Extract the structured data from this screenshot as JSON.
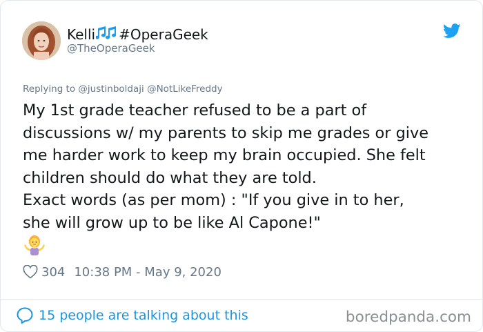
{
  "author": {
    "display_name_prefix": "Kelli",
    "display_name_suffix": "#OperaGeek",
    "handle": "@TheOperaGeek",
    "avatar_icon": "avatar-photo"
  },
  "tweet": {
    "reply_to_label": "Replying to",
    "reply_mention_1": "@justinboldaji",
    "reply_mention_2": "@NotLikeFreddy",
    "lines": [
      "My 1st grade teacher refused to be a part of",
      "discussions w/ my parents to skip me grades or give",
      "me harder work to keep my brain occupied. She felt",
      "children should do what they are told.",
      "Exact words (as per mom) : \"If you give in to her,",
      "she will grow up to be like Al Capone!\""
    ],
    "emoji_icon": "person-shrugging-emoji",
    "like_count": "304",
    "timestamp": "10:38 PM - May 9, 2020"
  },
  "footer": {
    "conversation_text": "15 people are talking about this",
    "watermark": "boredpanda.com"
  },
  "colors": {
    "link_blue": "#1b95e0",
    "twitter_blue": "#1da1f2",
    "muted_gray": "#657786",
    "text_dark": "#14171a",
    "border": "#e1e8ed"
  }
}
